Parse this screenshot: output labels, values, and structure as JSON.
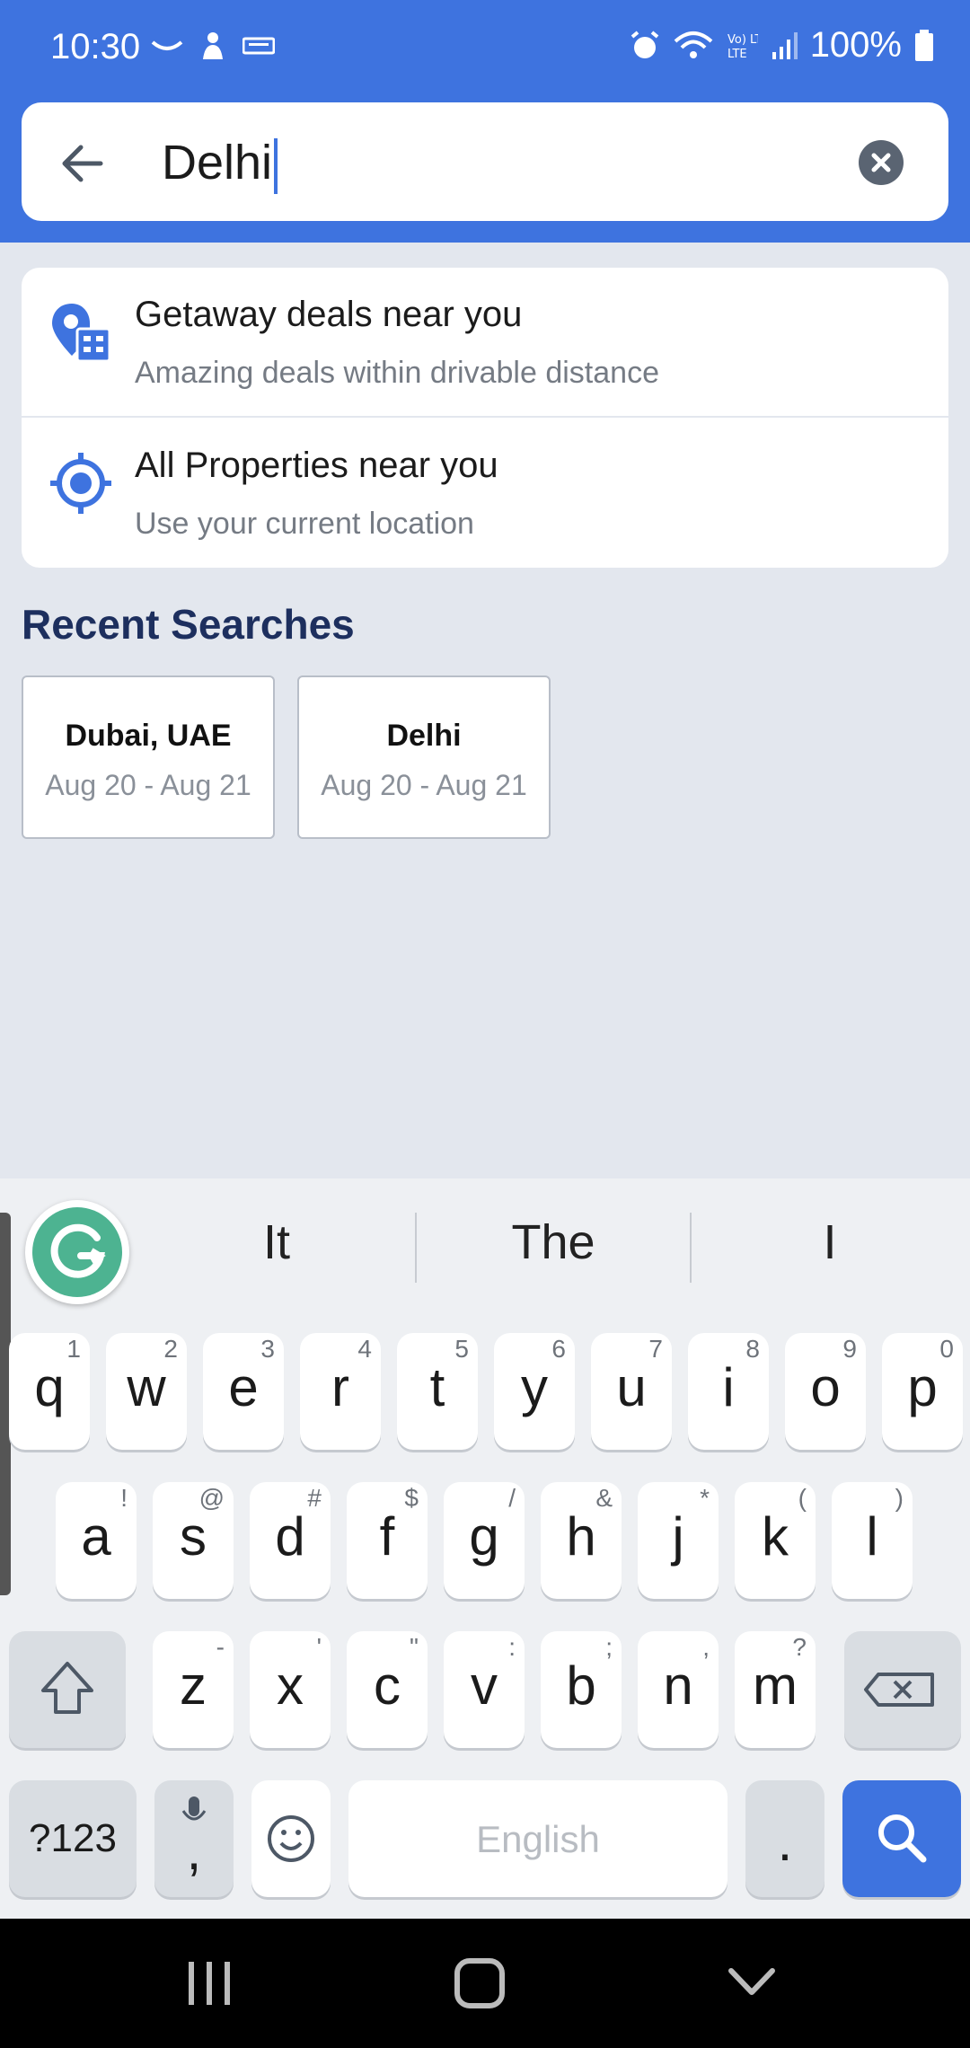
{
  "status_bar": {
    "time": "10:30",
    "battery": "100%",
    "network": "Vo) LTE"
  },
  "search": {
    "query": "Delhi",
    "back_icon": "arrow-left-icon",
    "clear_icon": "clear-circle-icon"
  },
  "suggestions": [
    {
      "title": "Getaway deals near you",
      "subtitle": "Amazing deals within drivable distance",
      "icon": "map-pin-building-icon"
    },
    {
      "title": "All Properties near you",
      "subtitle": "Use your current location",
      "icon": "crosshair-location-icon"
    }
  ],
  "recent": {
    "title": "Recent Searches",
    "items": [
      {
        "title": "Dubai, UAE",
        "dates": "Aug 20 - Aug 21"
      },
      {
        "title": "Delhi",
        "dates": "Aug 20 - Aug 21"
      }
    ]
  },
  "keyboard": {
    "predictions": [
      "It",
      "The",
      "I"
    ],
    "row1": [
      {
        "k": "q",
        "h": "1"
      },
      {
        "k": "w",
        "h": "2"
      },
      {
        "k": "e",
        "h": "3"
      },
      {
        "k": "r",
        "h": "4"
      },
      {
        "k": "t",
        "h": "5"
      },
      {
        "k": "y",
        "h": "6"
      },
      {
        "k": "u",
        "h": "7"
      },
      {
        "k": "i",
        "h": "8"
      },
      {
        "k": "o",
        "h": "9"
      },
      {
        "k": "p",
        "h": "0"
      }
    ],
    "row2": [
      {
        "k": "a",
        "h": "!"
      },
      {
        "k": "s",
        "h": "@"
      },
      {
        "k": "d",
        "h": "#"
      },
      {
        "k": "f",
        "h": "$"
      },
      {
        "k": "g",
        "h": "/"
      },
      {
        "k": "h",
        "h": "&"
      },
      {
        "k": "j",
        "h": "*"
      },
      {
        "k": "k",
        "h": "("
      },
      {
        "k": "l",
        "h": ")"
      }
    ],
    "row3": [
      {
        "k": "z",
        "h": "-"
      },
      {
        "k": "x",
        "h": "'"
      },
      {
        "k": "c",
        "h": "\""
      },
      {
        "k": "v",
        "h": ":"
      },
      {
        "k": "b",
        "h": ";"
      },
      {
        "k": "n",
        "h": ","
      },
      {
        "k": "m",
        "h": "?"
      }
    ],
    "symbols_label": "?123",
    "comma_label": ",",
    "space_label": "English",
    "period_label": "."
  },
  "colors": {
    "accent": "#3e73df",
    "background": "#e3e7ee",
    "heading": "#1d2f5e"
  }
}
